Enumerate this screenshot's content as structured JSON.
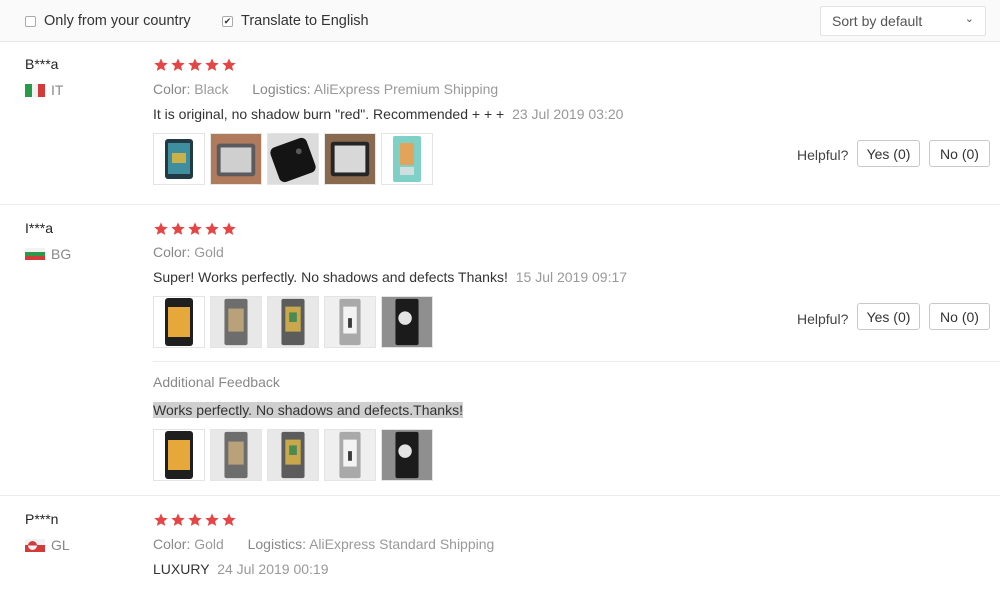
{
  "filters": {
    "only_country": {
      "label": "Only from your country",
      "checked": false
    },
    "translate": {
      "label": "Translate to English",
      "checked": true
    },
    "sort": {
      "label": "Sort by default"
    }
  },
  "reviews": [
    {
      "user": "B***a",
      "country": "IT",
      "rating": 5,
      "color_label": "Color:",
      "color": "Black",
      "logistics_label": "Logistics:",
      "logistics": "AliExpress Premium Shipping",
      "text": "It is original, no shadow burn \"red\". Recommended + + +",
      "date": "23 Jul 2019 03:20",
      "helpful_label": "Helpful?",
      "yes": "Yes (0)",
      "no": "No (0)"
    },
    {
      "user": "I***a",
      "country": "BG",
      "rating": 5,
      "color_label": "Color:",
      "color": "Gold",
      "text": "Super! Works perfectly. No shadows and defects Thanks!",
      "date": "15 Jul 2019 09:17",
      "helpful_label": "Helpful?",
      "yes": "Yes (0)",
      "no": "No (0)",
      "additional_label": "Additional Feedback",
      "additional_text": "Works perfectly. No shadows and defects.Thanks!"
    },
    {
      "user": "P***n",
      "country": "GL",
      "rating": 5,
      "color_label": "Color:",
      "color": "Gold",
      "logistics_label": "Logistics:",
      "logistics": "AliExpress Standard Shipping",
      "text": "LUXURY",
      "date": "24 Jul 2019 00:19"
    }
  ],
  "colors": {
    "star": "#e64545",
    "text": "#333333",
    "muted": "#999999",
    "highlight": "#cfcfcf"
  }
}
